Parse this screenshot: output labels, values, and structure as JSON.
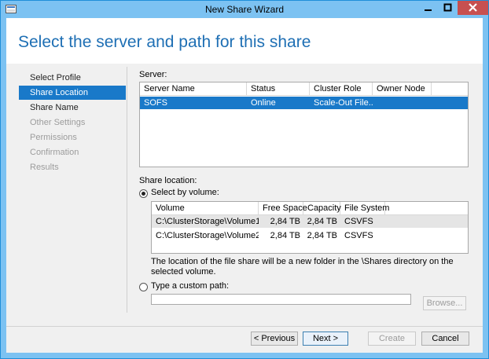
{
  "window": {
    "title": "New Share Wizard",
    "accent": "#1f8fd9"
  },
  "page_title": "Select the server and path for this share",
  "nav": {
    "items": [
      {
        "label": "Select Profile",
        "state": "normal"
      },
      {
        "label": "Share Location",
        "state": "selected"
      },
      {
        "label": "Share Name",
        "state": "normal"
      },
      {
        "label": "Other Settings",
        "state": "disabled"
      },
      {
        "label": "Permissions",
        "state": "disabled"
      },
      {
        "label": "Confirmation",
        "state": "disabled"
      },
      {
        "label": "Results",
        "state": "disabled"
      }
    ]
  },
  "server": {
    "label": "Server:",
    "columns": [
      "Server Name",
      "Status",
      "Cluster Role",
      "Owner Node"
    ],
    "rows": [
      {
        "server_name": "SOFS",
        "status": "Online",
        "cluster_role": "Scale-Out File...",
        "owner_node": "",
        "selected": true
      }
    ]
  },
  "share_location": {
    "label": "Share location:",
    "by_volume": {
      "label": "Select by volume:",
      "checked": true,
      "columns": [
        "Volume",
        "Free Space",
        "Capacity",
        "File System"
      ],
      "rows": [
        {
          "volume": "C:\\ClusterStorage\\Volume1",
          "free_space": "2,84 TB",
          "capacity": "2,84 TB",
          "file_system": "CSVFS"
        },
        {
          "volume": "C:\\ClusterStorage\\Volume2",
          "free_space": "2,84 TB",
          "capacity": "2,84 TB",
          "file_system": "CSVFS"
        }
      ],
      "note": "The location of the file share will be a new folder in the \\Shares directory on the selected volume."
    },
    "custom_path": {
      "label": "Type a custom path:",
      "checked": false,
      "value": "",
      "browse_label": "Browse..."
    }
  },
  "buttons": {
    "previous": "< Previous",
    "next": "Next >",
    "create": "Create",
    "cancel": "Cancel"
  }
}
